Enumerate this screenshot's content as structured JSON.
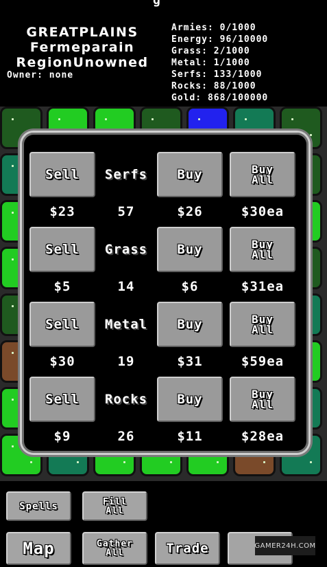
{
  "header": {
    "region_lines": [
      "GREATPLAINS",
      "Fermeparain",
      "RegionUnowned"
    ],
    "owner": "Owner: none",
    "stats": [
      "Armies: 0/1000",
      "Energy: 96/10000",
      "Grass: 2/1000",
      "Metal: 1/1000",
      "Serfs: 133/1000",
      "Rocks: 88/1000",
      "Gold: 868/100000"
    ]
  },
  "trade_panel": {
    "rows": [
      {
        "resource": "Serfs",
        "sell_label": "Sell",
        "buy_label": "Buy",
        "buy_all_label": "Buy All",
        "sell_price": "$23",
        "quantity": "57",
        "buy_price": "$26",
        "buy_all_price": "$30ea"
      },
      {
        "resource": "Grass",
        "sell_label": "Sell",
        "buy_label": "Buy",
        "buy_all_label": "Buy All",
        "sell_price": "$5",
        "quantity": "14",
        "buy_price": "$6",
        "buy_all_price": "$31ea"
      },
      {
        "resource": "Metal",
        "sell_label": "Sell",
        "buy_label": "Buy",
        "buy_all_label": "Buy All",
        "sell_price": "$30",
        "quantity": "19",
        "buy_price": "$31",
        "buy_all_price": "$59ea"
      },
      {
        "resource": "Rocks",
        "sell_label": "Sell",
        "buy_label": "Buy",
        "buy_all_label": "Buy All",
        "sell_price": "$9",
        "quantity": "26",
        "buy_price": "$11",
        "buy_all_price": "$28ea"
      }
    ]
  },
  "bottom_bar": {
    "spells": "Spells",
    "fill_all": "Fill All",
    "map": "Map",
    "gather_all": "Gather All",
    "trade": "Trade"
  },
  "watermark": "GAMER24H.COM",
  "colors": {
    "grass_bright": "#22cc22",
    "grass_dark": "#1f5a1f",
    "water_teal": "#137a55",
    "player_blue": "#2222ee",
    "dirt_brown": "#7a4a2a",
    "button_gray": "#9a9a9a"
  },
  "map_tiles": [
    {
      "c": "#1f5a1f"
    },
    {
      "c": "#22cc22"
    },
    {
      "c": "#22cc22"
    },
    {
      "c": "#1f5a1f"
    },
    {
      "c": "#2222ee"
    },
    {
      "c": "#137a55"
    },
    {
      "c": "#1f5a1f"
    },
    {
      "c": "#137a55"
    },
    {
      "c": "#22cc22"
    },
    {
      "c": "#1f5a1f"
    },
    {
      "c": "#22cc22"
    },
    {
      "c": "#137a55"
    },
    {
      "c": "#1f5a1f"
    },
    {
      "c": "#1f5a1f"
    },
    {
      "c": "#22cc22"
    },
    {
      "c": "#1f5a1f"
    },
    {
      "c": "#22cc22"
    },
    {
      "c": "#137a55"
    },
    {
      "c": "#22cc22"
    },
    {
      "c": "#1f5a1f"
    },
    {
      "c": "#22cc22"
    },
    {
      "c": "#22cc22"
    },
    {
      "c": "#137a55"
    },
    {
      "c": "#1f5a1f"
    },
    {
      "c": "#22cc22"
    },
    {
      "c": "#1f5a1f"
    },
    {
      "c": "#22cc22"
    },
    {
      "c": "#1f5a1f"
    },
    {
      "c": "#1f5a1f"
    },
    {
      "c": "#22cc22"
    },
    {
      "c": "#137a55"
    },
    {
      "c": "#1f5a1f"
    },
    {
      "c": "#22cc22"
    },
    {
      "c": "#137a55"
    },
    {
      "c": "#137a55"
    },
    {
      "c": "#7a4a2a"
    },
    {
      "c": "#1f5a1f"
    },
    {
      "c": "#22cc22"
    },
    {
      "c": "#22cc22"
    },
    {
      "c": "#137a55"
    },
    {
      "c": "#1f5a1f"
    },
    {
      "c": "#22cc22"
    },
    {
      "c": "#22cc22"
    },
    {
      "c": "#137a55"
    },
    {
      "c": "#1f5a1f"
    },
    {
      "c": "#22cc22"
    },
    {
      "c": "#22cc22"
    },
    {
      "c": "#1f5a1f"
    },
    {
      "c": "#137a55"
    },
    {
      "c": "#22cc22"
    },
    {
      "c": "#137a55"
    },
    {
      "c": "#22cc22"
    },
    {
      "c": "#22cc22"
    },
    {
      "c": "#22cc22"
    },
    {
      "c": "#7a4a2a"
    },
    {
      "c": "#137a55"
    }
  ]
}
